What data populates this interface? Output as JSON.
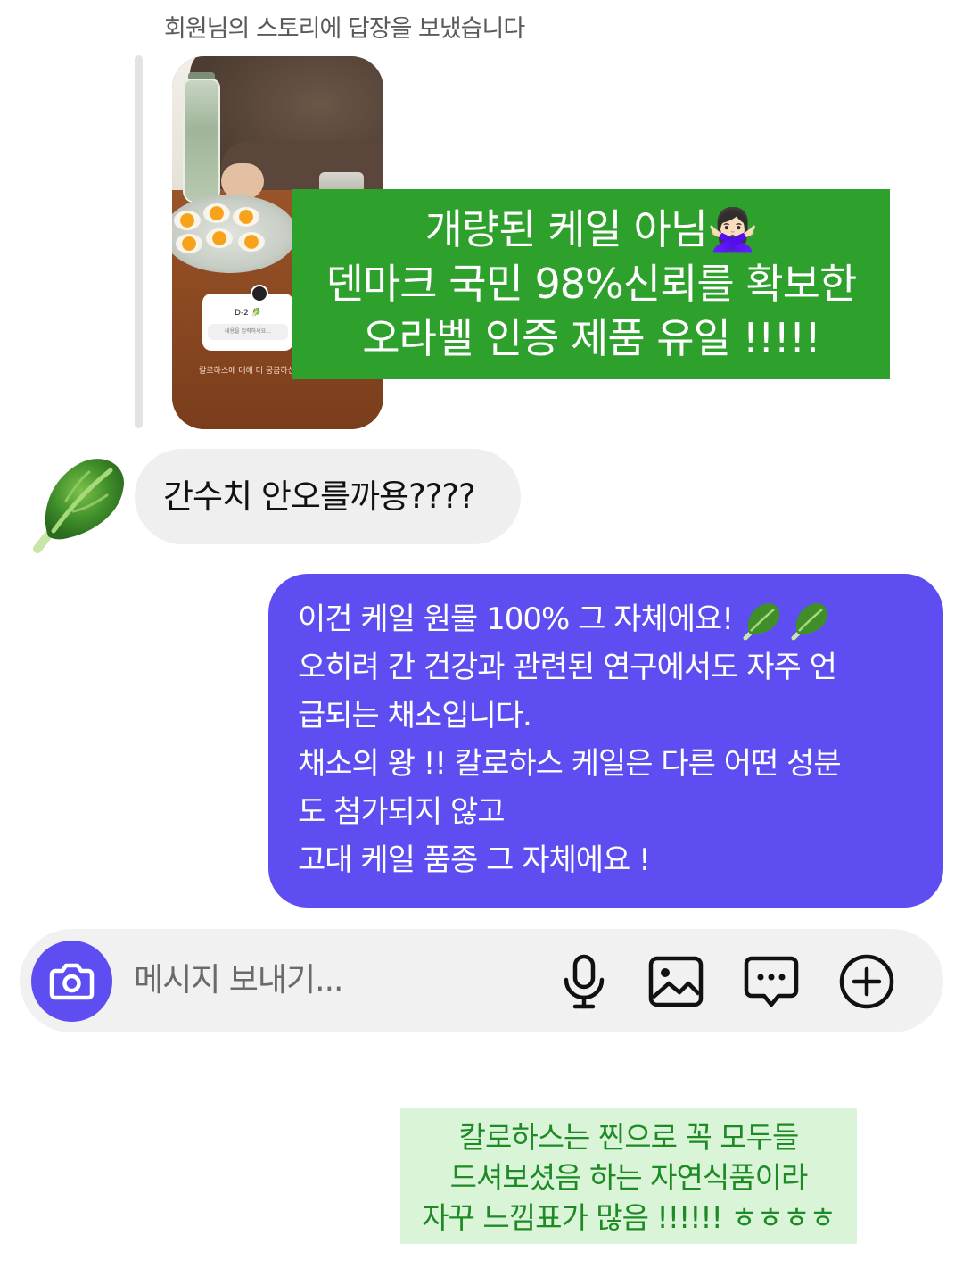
{
  "story_reply": {
    "caption": "회원님의 스토리에 답장을 보냈습니다",
    "story": {
      "question_title": "D-2 🥬",
      "question_placeholder": "내용을 입력하세요...",
      "question_caption": "칼로하스에 대해 더 궁금하신"
    }
  },
  "overlay": {
    "lines": [
      "개량된 케일 아님🙅🏻‍♀️",
      "덴마크 국민 98%신뢰를 확보한",
      "오라벨 인증 제품 유일 !!!!!"
    ],
    "color": "#2ea02c"
  },
  "incoming": {
    "avatar_icon": "lettuce-icon",
    "text": "간수치 안오를까용????"
  },
  "outgoing": {
    "color": "#5e4ef1",
    "lines": [
      "이건 케일 원물 100% 그 자체에요!",
      "오히려 간 건강과 관련된 연구에서도 자주 언",
      "급되는 채소입니다.",
      "채소의 왕 !! 칼로하스 케일은 다른 어떤 성분",
      "도 첨가되지 않고",
      "고대 케일 품종 그 자체에요 !"
    ]
  },
  "composer": {
    "placeholder": "메시지 보내기...",
    "icons": [
      "camera-icon",
      "microphone-icon",
      "image-icon",
      "chat-bubble-icon",
      "plus-circle-icon"
    ]
  },
  "annotation": {
    "lines": [
      "칼로하스는 찐으로 꼭 모두들",
      "드셔보셨음 하는 자연식품이라",
      "자꾸 느낌표가 많음 !!!!!! ㅎㅎㅎㅎ"
    ],
    "color": "#d9f4d6"
  }
}
